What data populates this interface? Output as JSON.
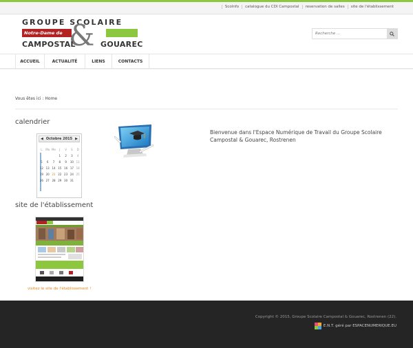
{
  "toplinks": [
    "ScoInfo",
    "catalogue du CDI Campostal",
    "reservation de salles",
    "site de l'établissement"
  ],
  "logo": {
    "line1": "GROUPE SCOLAIRE",
    "redtag": "Notre-Dame de",
    "ampersand": "&",
    "campostal": "CAMPOSTAL",
    "gouarec": "GOUAREC"
  },
  "search": {
    "placeholder": "Recherche ..."
  },
  "nav": [
    "ACCUEIL",
    "ACTUALITÉ",
    "LIENS",
    "CONTACTS"
  ],
  "breadcrumb": "Vous êtes ici : Home",
  "calendar": {
    "title": "calendrier",
    "month": "Octobre 2015",
    "weekdays": [
      "L",
      "Ma",
      "Me",
      "J",
      "V",
      "S",
      "D"
    ],
    "rows": [
      [
        "",
        "",
        "",
        "1",
        "2",
        "3",
        "4"
      ],
      [
        "5",
        "6",
        "7",
        "8",
        "9",
        "10",
        "11"
      ],
      [
        "12",
        "13",
        "14",
        "15",
        "16",
        "17",
        "18"
      ],
      [
        "19",
        "20",
        "21",
        "22",
        "23",
        "24",
        "25"
      ],
      [
        "26",
        "27",
        "28",
        "29",
        "30",
        "31",
        ""
      ]
    ],
    "today": "21"
  },
  "welcome": "Bienvenue dans l'Espace Numérique de Travail du Groupe Scolaire Campostal & Gouarec, Rostrenen",
  "site": {
    "title": "site de l'établissement",
    "link": "visitez le site de l'établissement !"
  },
  "footer": {
    "copyright": "Copyright © 2015, Groupe Scolaire Campostal & Gouarec, Rostrenen (22).",
    "ent": "E.N.T. géré par ESPACENUMERIQUE.EU"
  },
  "colors": {
    "accent": "#8dc63f",
    "brandRed": "#b22222",
    "link": "#e08a1e",
    "footer": "#252525"
  }
}
